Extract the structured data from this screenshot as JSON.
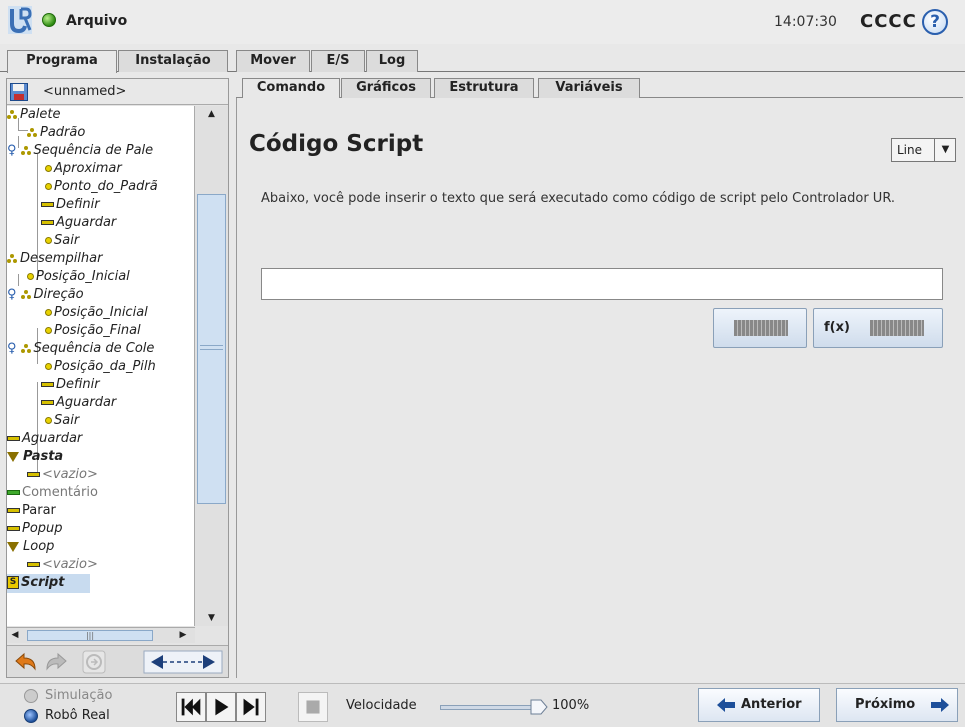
{
  "header": {
    "app_title": "Arquivo",
    "clock": "14:07:30",
    "robot_name": "CCCC",
    "help_label": "?"
  },
  "main_tabs": [
    "Programa",
    "Instalação",
    "Mover",
    "E/S",
    "Log"
  ],
  "program": {
    "name": "<unnamed>"
  },
  "tree": [
    {
      "label": "Palete",
      "icon": "pallet-icon"
    },
    {
      "label": "Padrão",
      "icon": "pallet-icon"
    },
    {
      "label": "Sequência de Pale",
      "icon": "pallet-icon"
    },
    {
      "label": "Aproximar",
      "icon": "waypoint-icon"
    },
    {
      "label": "Ponto_do_Padrã",
      "icon": "waypoint-icon"
    },
    {
      "label": "Definir",
      "icon": "command-icon"
    },
    {
      "label": "Aguardar",
      "icon": "command-icon"
    },
    {
      "label": "Sair",
      "icon": "waypoint-icon"
    },
    {
      "label": "Desempilhar",
      "icon": "pallet-icon"
    },
    {
      "label": "Posição_Inicial",
      "icon": "waypoint-icon"
    },
    {
      "label": "Direção",
      "icon": "pallet-icon"
    },
    {
      "label": "Posição_Inicial",
      "icon": "waypoint-icon"
    },
    {
      "label": "Posição_Final",
      "icon": "waypoint-icon"
    },
    {
      "label": "Sequência de Cole",
      "icon": "pallet-icon"
    },
    {
      "label": "Posição_da_Pilh",
      "icon": "waypoint-icon"
    },
    {
      "label": "Definir",
      "icon": "command-icon"
    },
    {
      "label": "Aguardar",
      "icon": "command-icon"
    },
    {
      "label": "Sair",
      "icon": "waypoint-icon"
    },
    {
      "label": "Aguardar",
      "icon": "command-icon"
    },
    {
      "label": "Pasta",
      "icon": "folder-icon"
    },
    {
      "label": "<vazio>",
      "icon": "command-icon"
    },
    {
      "label": "Comentário",
      "icon": "comment-icon"
    },
    {
      "label": "Parar",
      "icon": "command-icon"
    },
    {
      "label": "Popup",
      "icon": "command-icon"
    },
    {
      "label": "Loop",
      "icon": "loop-icon"
    },
    {
      "label": "<vazio>",
      "icon": "command-icon"
    },
    {
      "label": "Script",
      "icon": "script-icon"
    }
  ],
  "sub_tabs": [
    "Comando",
    "Gráficos",
    "Estrutura",
    "Variáveis"
  ],
  "content": {
    "title": "Código Script",
    "mode": "Line",
    "description": "Abaixo, você pode inserir o texto que será executado como código de script pelo Controlador UR.",
    "script_value": "",
    "fx_label": "f(x)"
  },
  "bottom": {
    "simulation_label": "Simulação",
    "real_robot_label": "Robô Real",
    "speed_label": "Velocidade",
    "speed_value": "100%",
    "speed_fraction": 1.0,
    "prev_label": "Anterior",
    "next_label": "Próximo"
  },
  "colors": {
    "selection": "#c8dbef",
    "accent_blue": "#2a5fae",
    "status_green": "#2d8a12"
  }
}
